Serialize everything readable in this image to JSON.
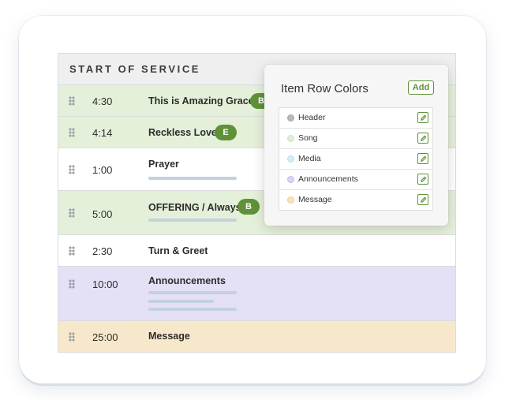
{
  "plan": {
    "section_title": "START OF SERVICE",
    "items": [
      {
        "time": "4:30",
        "title": "This is Amazing Grace",
        "badge": "B",
        "type": "song"
      },
      {
        "time": "4:14",
        "title": "Reckless Love",
        "badge": "E",
        "type": "song"
      },
      {
        "time": "1:00",
        "title": "Prayer",
        "type": "plain"
      },
      {
        "time": "5:00",
        "title": "OFFERING / Always",
        "badge": "B",
        "type": "song"
      },
      {
        "time": "2:30",
        "title": "Turn & Greet",
        "type": "plain"
      },
      {
        "time": "10:00",
        "title": "Announcements",
        "type": "announcements"
      },
      {
        "time": "25:00",
        "title": "Message",
        "type": "message"
      }
    ]
  },
  "row_colors_popover": {
    "title": "Item Row Colors",
    "add_label": "Add",
    "colors": [
      {
        "label": "Header",
        "color": "#b9b9b9",
        "icon": "pencil-edit-icon"
      },
      {
        "label": "Song",
        "color": "#e1efd6",
        "icon": "pencil-edit-icon"
      },
      {
        "label": "Media",
        "color": "#d6ecf4",
        "icon": "pencil-edit-icon"
      },
      {
        "label": "Announcements",
        "color": "#d9d4f4",
        "icon": "pencil-edit-icon"
      },
      {
        "label": "Message",
        "color": "#f7e3c0",
        "icon": "pencil-edit-icon"
      }
    ]
  },
  "colors": {
    "accent_green": "#5f9238",
    "song_row": "#e5f0da",
    "announcements_row": "#e4e0f6",
    "message_row": "#f8e8cb",
    "header_row": "#efefef"
  }
}
